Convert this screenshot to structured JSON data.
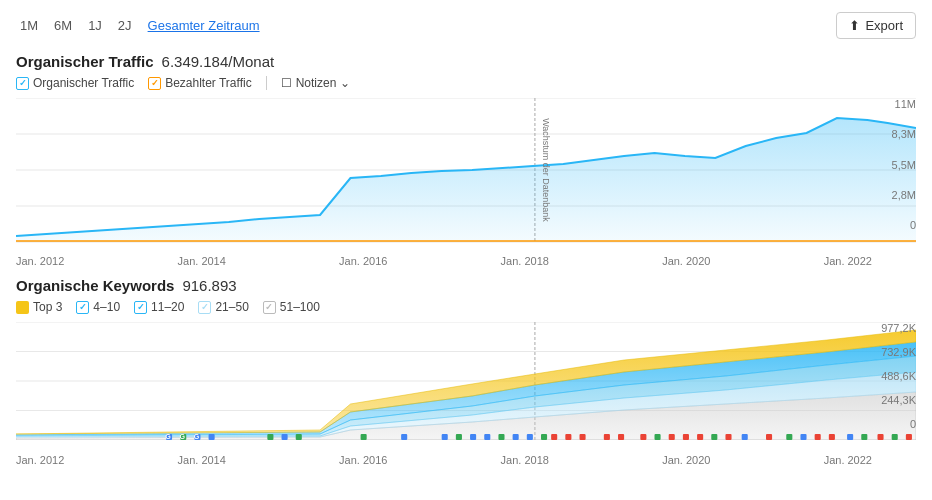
{
  "timeRange": {
    "options": [
      "1M",
      "6M",
      "1J",
      "2J",
      "Gesamter Zeitraum"
    ],
    "active": "Gesamter Zeitraum",
    "exportLabel": "Export"
  },
  "organicTraffic": {
    "title": "Organischer Traffic",
    "value": "6.349.184/Monat",
    "legend": [
      {
        "label": "Organischer Traffic",
        "color": "#29b6f6",
        "checked": true
      },
      {
        "label": "Bezahlter Traffic",
        "color": "#ff9800",
        "checked": true
      }
    ],
    "notizen": "Notizen",
    "yAxis": [
      "11M",
      "8,3M",
      "5,5M",
      "2,8M",
      "0"
    ],
    "xAxis": [
      "Jan. 2012",
      "Jan. 2014",
      "Jan. 2016",
      "Jan. 2018",
      "Jan. 2020",
      "Jan. 2022"
    ],
    "annotation": "Wachstum der Datenbank"
  },
  "organicKeywords": {
    "title": "Organische Keywords",
    "value": "916.893",
    "legend": [
      {
        "label": "Top 3",
        "color": "#f5c518",
        "checked": true
      },
      {
        "label": "4–10",
        "color": "#29b6f6",
        "checked": true
      },
      {
        "label": "11–20",
        "color": "#64c8f0",
        "checked": true
      },
      {
        "label": "21–50",
        "color": "#a8ddf5",
        "checked": true
      },
      {
        "label": "51–100",
        "color": "#ccc",
        "checked": true
      }
    ],
    "yAxis": [
      "977,2K",
      "732,9K",
      "488,6K",
      "244,3K",
      "0"
    ],
    "xAxis": [
      "Jan. 2012",
      "Jan. 2014",
      "Jan. 2016",
      "Jan. 2018",
      "Jan. 2020",
      "Jan. 2022"
    ]
  }
}
